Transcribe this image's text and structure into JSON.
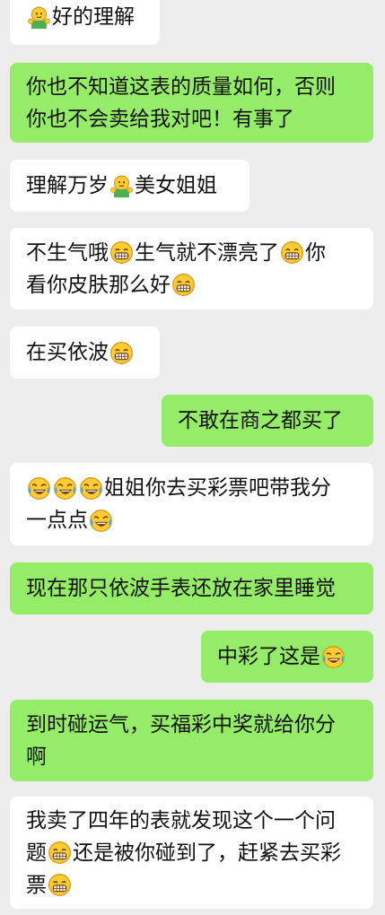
{
  "colors": {
    "background": "#ededed",
    "incoming_bubble": "#ffffff",
    "outgoing_bubble": "#95ec69",
    "text": "#111111"
  },
  "messages": [
    {
      "side": "in",
      "lines": [
        [
          {
            "emoji": "hug-emoji"
          },
          {
            "text": "好的理解"
          }
        ]
      ]
    },
    {
      "side": "out",
      "lines": [
        [
          {
            "text": "你也不知道这表的质量如何，否则"
          }
        ],
        [
          {
            "text": "你也不会卖给我对吧！有事了"
          }
        ]
      ]
    },
    {
      "side": "in",
      "lines": [
        [
          {
            "text": "理解万岁"
          },
          {
            "emoji": "hug-emoji"
          },
          {
            "text": "美女姐姐"
          }
        ]
      ]
    },
    {
      "side": "in",
      "lines": [
        [
          {
            "text": "不生气哦"
          },
          {
            "emoji": "grin-emoji"
          },
          {
            "text": "生气就不漂亮了"
          },
          {
            "emoji": "grin-emoji"
          },
          {
            "text": "你"
          }
        ],
        [
          {
            "text": "看你皮肤那么好"
          },
          {
            "emoji": "grin-emoji"
          }
        ]
      ]
    },
    {
      "side": "in",
      "lines": [
        [
          {
            "text": "在买依波"
          },
          {
            "emoji": "grin-emoji"
          }
        ]
      ]
    },
    {
      "side": "out",
      "lines": [
        [
          {
            "text": "不敢在商之都买了"
          }
        ]
      ]
    },
    {
      "side": "in",
      "lines": [
        [
          {
            "emoji": "cry-laugh-emoji"
          },
          {
            "emoji": "cry-laugh-emoji"
          },
          {
            "emoji": "cry-laugh-emoji"
          },
          {
            "text": "姐姐你去买彩票吧带我分"
          }
        ],
        [
          {
            "text": "一点点"
          },
          {
            "emoji": "cry-laugh-emoji"
          }
        ]
      ]
    },
    {
      "side": "out",
      "lines": [
        [
          {
            "text": "现在那只依波手表还放在家里睡觉"
          }
        ]
      ]
    },
    {
      "side": "out",
      "lines": [
        [
          {
            "text": "中彩了这是"
          },
          {
            "emoji": "cry-laugh-emoji"
          }
        ]
      ]
    },
    {
      "side": "out",
      "lines": [
        [
          {
            "text": "到时碰运气，买福彩中奖就给你分"
          }
        ],
        [
          {
            "text": "啊"
          }
        ]
      ]
    },
    {
      "side": "in",
      "lines": [
        [
          {
            "text": "我卖了四年的表就发现这个一个问"
          }
        ],
        [
          {
            "text": "题"
          },
          {
            "emoji": "grin-emoji"
          },
          {
            "text": "还是被你碰到了，赶紧去买彩"
          }
        ],
        [
          {
            "text": "票"
          },
          {
            "emoji": "grin-emoji"
          }
        ]
      ]
    }
  ]
}
